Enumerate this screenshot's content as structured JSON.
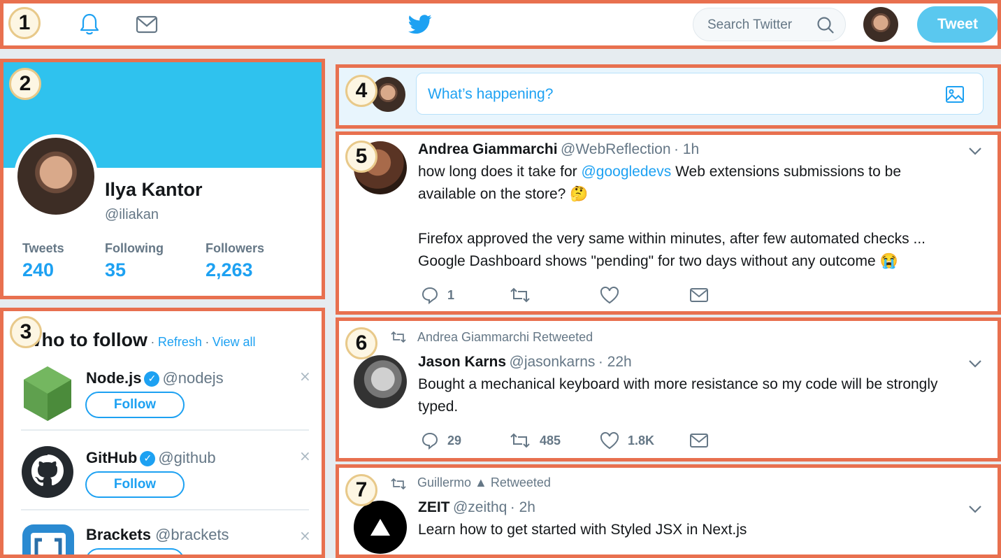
{
  "header": {
    "search_placeholder": "Search Twitter",
    "tweet_button": "Tweet"
  },
  "annotations": [
    "1",
    "2",
    "3",
    "4",
    "5",
    "6",
    "7"
  ],
  "profile": {
    "name": "Ilya Kantor",
    "handle": "@iliakan",
    "stats": [
      {
        "label": "Tweets",
        "value": "240"
      },
      {
        "label": "Following",
        "value": "35"
      },
      {
        "label": "Followers",
        "value": "2,263"
      }
    ]
  },
  "who_to_follow": {
    "title": "Who to follow",
    "refresh": "Refresh",
    "view_all": "View all",
    "separator": "·",
    "follow_label": "Follow",
    "close": "×",
    "accounts": [
      {
        "name": "Node.js",
        "handle": "@nodejs",
        "verified": true
      },
      {
        "name": "GitHub",
        "handle": "@github",
        "verified": true
      },
      {
        "name": "Brackets",
        "handle": "@brackets",
        "verified": false
      }
    ]
  },
  "compose": {
    "placeholder": "What’s happening?"
  },
  "tweets": [
    {
      "name": "Andrea Giammarchi",
      "handle": "@WebReflection",
      "time": "· 1h",
      "line1a": "how long does it take for ",
      "mention": "@googledevs",
      "line1b": " Web extensions submissions to be",
      "line2": "available on the store? 🤔",
      "line3": "Firefox approved the very same within minutes, after few automated checks ...",
      "line4": "Google Dashboard shows \"pending\" for two days without any outcome 😭",
      "replies": "1",
      "retweets": "",
      "likes": ""
    },
    {
      "retweeted_by": "Andrea Giammarchi Retweeted",
      "name": "Jason Karns",
      "handle": "@jasonkarns",
      "time": "· 22h",
      "line1": "Bought a mechanical keyboard with more resistance so my code will be strongly",
      "line2": "typed.",
      "replies": "29",
      "retweets": "485",
      "likes": "1.8K"
    },
    {
      "retweeted_by": "Guillermo ▲ Retweeted",
      "name": "ZEIT",
      "handle": "@zeithq",
      "time": "· 2h",
      "line1": "Learn how to get started with Styled JSX in Next.js"
    }
  ],
  "colors": {
    "accent": "#1da1f2",
    "banner": "#2fc2ee",
    "annotation_border": "#e8704f"
  }
}
